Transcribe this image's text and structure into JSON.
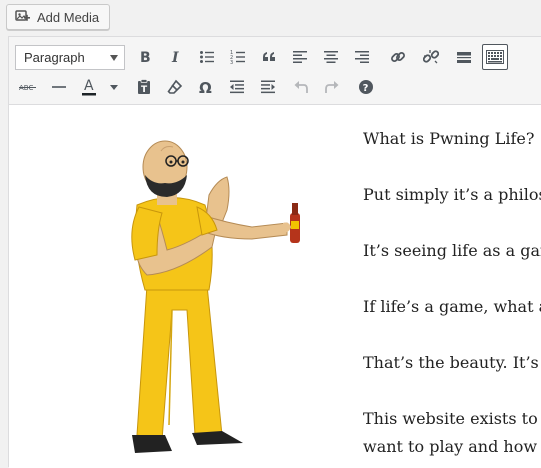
{
  "media": {
    "add_media_label": "Add Media",
    "icon": "add-media-icon"
  },
  "toolbar": {
    "format_select": {
      "selected": "Paragraph"
    },
    "row1": [
      {
        "name": "bold-button",
        "glyph": "B"
      },
      {
        "name": "italic-button",
        "glyph": "I"
      },
      {
        "name": "bulleted-list-button",
        "icon": "bullet-list-icon"
      },
      {
        "name": "numbered-list-button",
        "icon": "numbered-list-icon"
      },
      {
        "name": "blockquote-button",
        "glyph": "“"
      },
      {
        "name": "align-left-button",
        "icon": "align-left-icon"
      },
      {
        "name": "align-center-button",
        "icon": "align-center-icon"
      },
      {
        "name": "align-right-button",
        "icon": "align-right-icon"
      },
      {
        "name": "insert-link-button",
        "icon": "link-icon"
      },
      {
        "name": "remove-link-button",
        "icon": "unlink-icon"
      },
      {
        "name": "read-more-button",
        "icon": "read-more-icon"
      },
      {
        "name": "toolbar-toggle-button",
        "icon": "keyboard-icon",
        "active": true
      }
    ],
    "row2": [
      {
        "name": "strikethrough-button",
        "glyph": "ABC"
      },
      {
        "name": "horizontal-line-button",
        "icon": "horizontal-line-icon"
      },
      {
        "name": "text-color-button",
        "glyph": "A"
      },
      {
        "name": "paste-as-text-button",
        "icon": "paste-text-icon"
      },
      {
        "name": "clear-formatting-button",
        "icon": "eraser-icon"
      },
      {
        "name": "special-character-button",
        "glyph": "Ω"
      },
      {
        "name": "decrease-indent-button",
        "icon": "outdent-icon"
      },
      {
        "name": "increase-indent-button",
        "icon": "indent-icon"
      },
      {
        "name": "undo-button",
        "icon": "undo-icon"
      },
      {
        "name": "redo-button",
        "icon": "redo-icon"
      },
      {
        "name": "help-button",
        "icon": "help-icon"
      }
    ],
    "text_color": "#1d2327"
  },
  "content": {
    "paragraphs": [
      "What is Pwning Life?",
      "Put simply it’s a philos",
      "It’s seeing life as a gam",
      "If life’s a game, what a",
      "That’s the beauty. It’s",
      "This website exists to l",
      "want to play and how t"
    ],
    "image": "cartoon-man-with-bottle-illustration"
  },
  "colors": {
    "toolbar_bg": "#f5f5f5",
    "icon": "#50575e",
    "page_bg": "#f1f1f1",
    "shirt": "#f5c518",
    "pants": "#f2c200"
  }
}
